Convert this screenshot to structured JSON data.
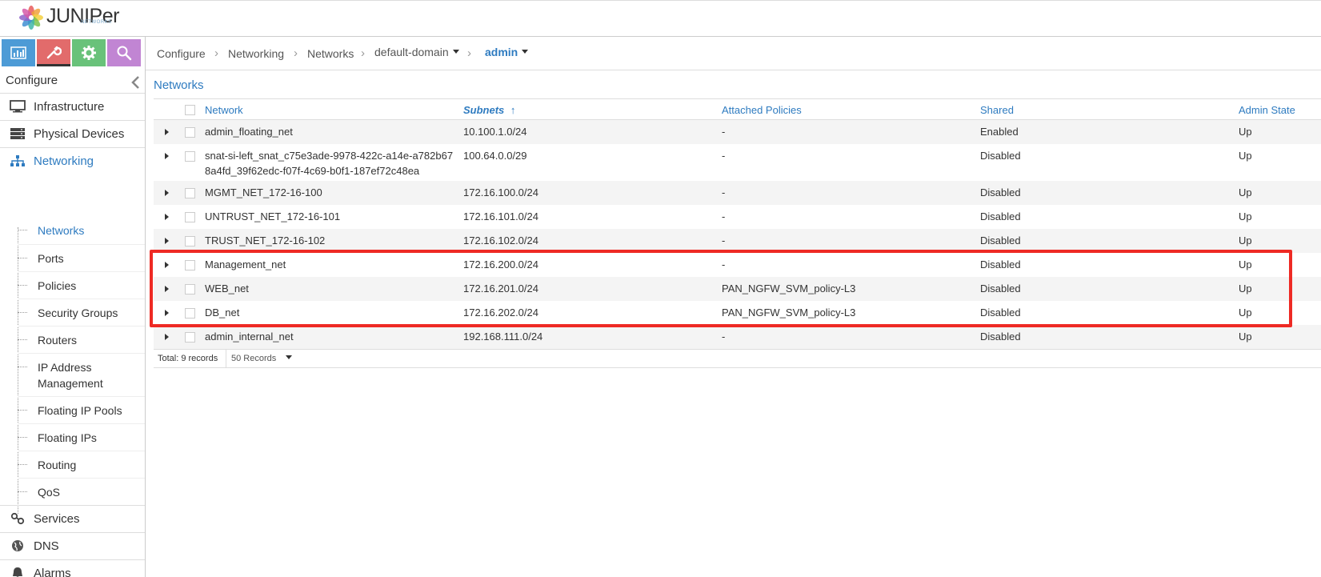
{
  "header": {
    "logo_text": "JUNIPer",
    "logo_sub": "NETWORKS"
  },
  "sidebar": {
    "mode_tabs": [
      {
        "name": "monitor",
        "icon": "bar-chart-icon"
      },
      {
        "name": "configure",
        "icon": "wrench-icon",
        "active": true
      },
      {
        "name": "settings",
        "icon": "gear-icon"
      },
      {
        "name": "query",
        "icon": "search-icon"
      }
    ],
    "title": "Configure",
    "items": [
      {
        "label": "Infrastructure",
        "icon": "monitor-icon"
      },
      {
        "label": "Physical Devices",
        "icon": "server-icon"
      },
      {
        "label": "Networking",
        "icon": "network-tree-icon",
        "active": true
      },
      {
        "label": "Services",
        "icon": "link-icon"
      },
      {
        "label": "DNS",
        "icon": "globe-icon"
      },
      {
        "label": "Alarms",
        "icon": "bell-icon"
      }
    ],
    "sub_items": [
      {
        "label": "Networks",
        "active": true
      },
      {
        "label": "Ports"
      },
      {
        "label": "Policies"
      },
      {
        "label": "Security Groups"
      },
      {
        "label": "Routers"
      },
      {
        "label": "IP Address Management"
      },
      {
        "label": "Floating IP Pools"
      },
      {
        "label": "Floating IPs"
      },
      {
        "label": "Routing"
      },
      {
        "label": "QoS"
      }
    ]
  },
  "breadcrumb": {
    "items": [
      "Configure",
      "Networking",
      "Networks"
    ],
    "domain": "default-domain",
    "project": "admin"
  },
  "main": {
    "title": "Networks",
    "columns": [
      "Network",
      "Subnets",
      "Attached Policies",
      "Shared",
      "Admin State"
    ],
    "sort_indicator": "↑",
    "rows": [
      {
        "network": "admin_floating_net",
        "subnets": "10.100.1.0/24",
        "policies": "-",
        "shared": "Enabled",
        "state": "Up"
      },
      {
        "network": "snat-si-left_snat_c75e3ade-9978-422c-a14e-a782b67 8a4fd_39f62edc-f07f-4c69-b0f1-187ef72c48ea",
        "subnets": "100.64.0.0/29",
        "policies": "-",
        "shared": "Disabled",
        "state": "Up"
      },
      {
        "network": "MGMT_NET_172-16-100",
        "subnets": "172.16.100.0/24",
        "policies": "-",
        "shared": "Disabled",
        "state": "Up"
      },
      {
        "network": "UNTRUST_NET_172-16-101",
        "subnets": "172.16.101.0/24",
        "policies": "-",
        "shared": "Disabled",
        "state": "Up"
      },
      {
        "network": "TRUST_NET_172-16-102",
        "subnets": "172.16.102.0/24",
        "policies": "-",
        "shared": "Disabled",
        "state": "Up"
      },
      {
        "network": "Management_net",
        "subnets": "172.16.200.0/24",
        "policies": "-",
        "shared": "Disabled",
        "state": "Up"
      },
      {
        "network": "WEB_net",
        "subnets": "172.16.201.0/24",
        "policies": "PAN_NGFW_SVM_policy-L3",
        "shared": "Disabled",
        "state": "Up"
      },
      {
        "network": "DB_net",
        "subnets": "172.16.202.0/24",
        "policies": "PAN_NGFW_SVM_policy-L3",
        "shared": "Disabled",
        "state": "Up"
      },
      {
        "network": "admin_internal_net",
        "subnets": "192.168.111.0/24",
        "policies": "-",
        "shared": "Disabled",
        "state": "Up"
      }
    ],
    "footer": {
      "total": "Total: 9 records",
      "per_page": "50 Records"
    }
  },
  "colors": {
    "accent": "#2e7bc0",
    "highlight": "#ee2a24"
  }
}
